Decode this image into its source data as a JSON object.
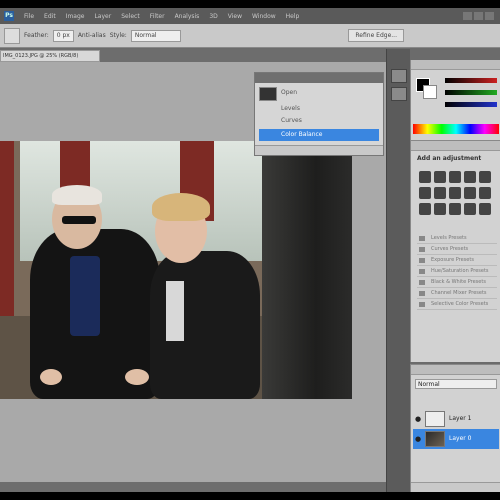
{
  "app": {
    "logo_text": "Ps",
    "accent": "#3a86e0"
  },
  "menu": {
    "items": [
      "File",
      "Edit",
      "Image",
      "Layer",
      "Select",
      "Filter",
      "Analysis",
      "3D",
      "View",
      "Window",
      "Help"
    ]
  },
  "options_bar": {
    "labels": [
      "Feather:",
      "Anti-alias",
      "Style:"
    ],
    "feather_value": "0 px",
    "style_value": "Normal",
    "refine_edge_label": "Refine Edge..."
  },
  "document": {
    "tab_title": "IMG_0123.JPG @ 25% (RGB/8)"
  },
  "history_panel": {
    "rows": [
      "Open",
      "Levels",
      "Curves",
      "Color Balance"
    ],
    "selected_index": 3
  },
  "color_panel": {
    "slider_colors": [
      "#cc2222",
      "#22aa22",
      "#2233cc"
    ]
  },
  "adjustments_panel": {
    "title": "Add an adjustment",
    "presets": [
      "Levels Presets",
      "Curves Presets",
      "Exposure Presets",
      "Hue/Saturation Presets",
      "Black & White Presets",
      "Channel Mixer Presets",
      "Selective Color Presets"
    ]
  },
  "layers_panel": {
    "blend_mode": "Normal",
    "layers": [
      "Layer 1",
      "Layer 0"
    ],
    "selected_index": 1
  },
  "icons": [
    "photoshop-logo-icon",
    "eye-icon",
    "marquee-tool-icon",
    "panel-collapse-icon"
  ]
}
